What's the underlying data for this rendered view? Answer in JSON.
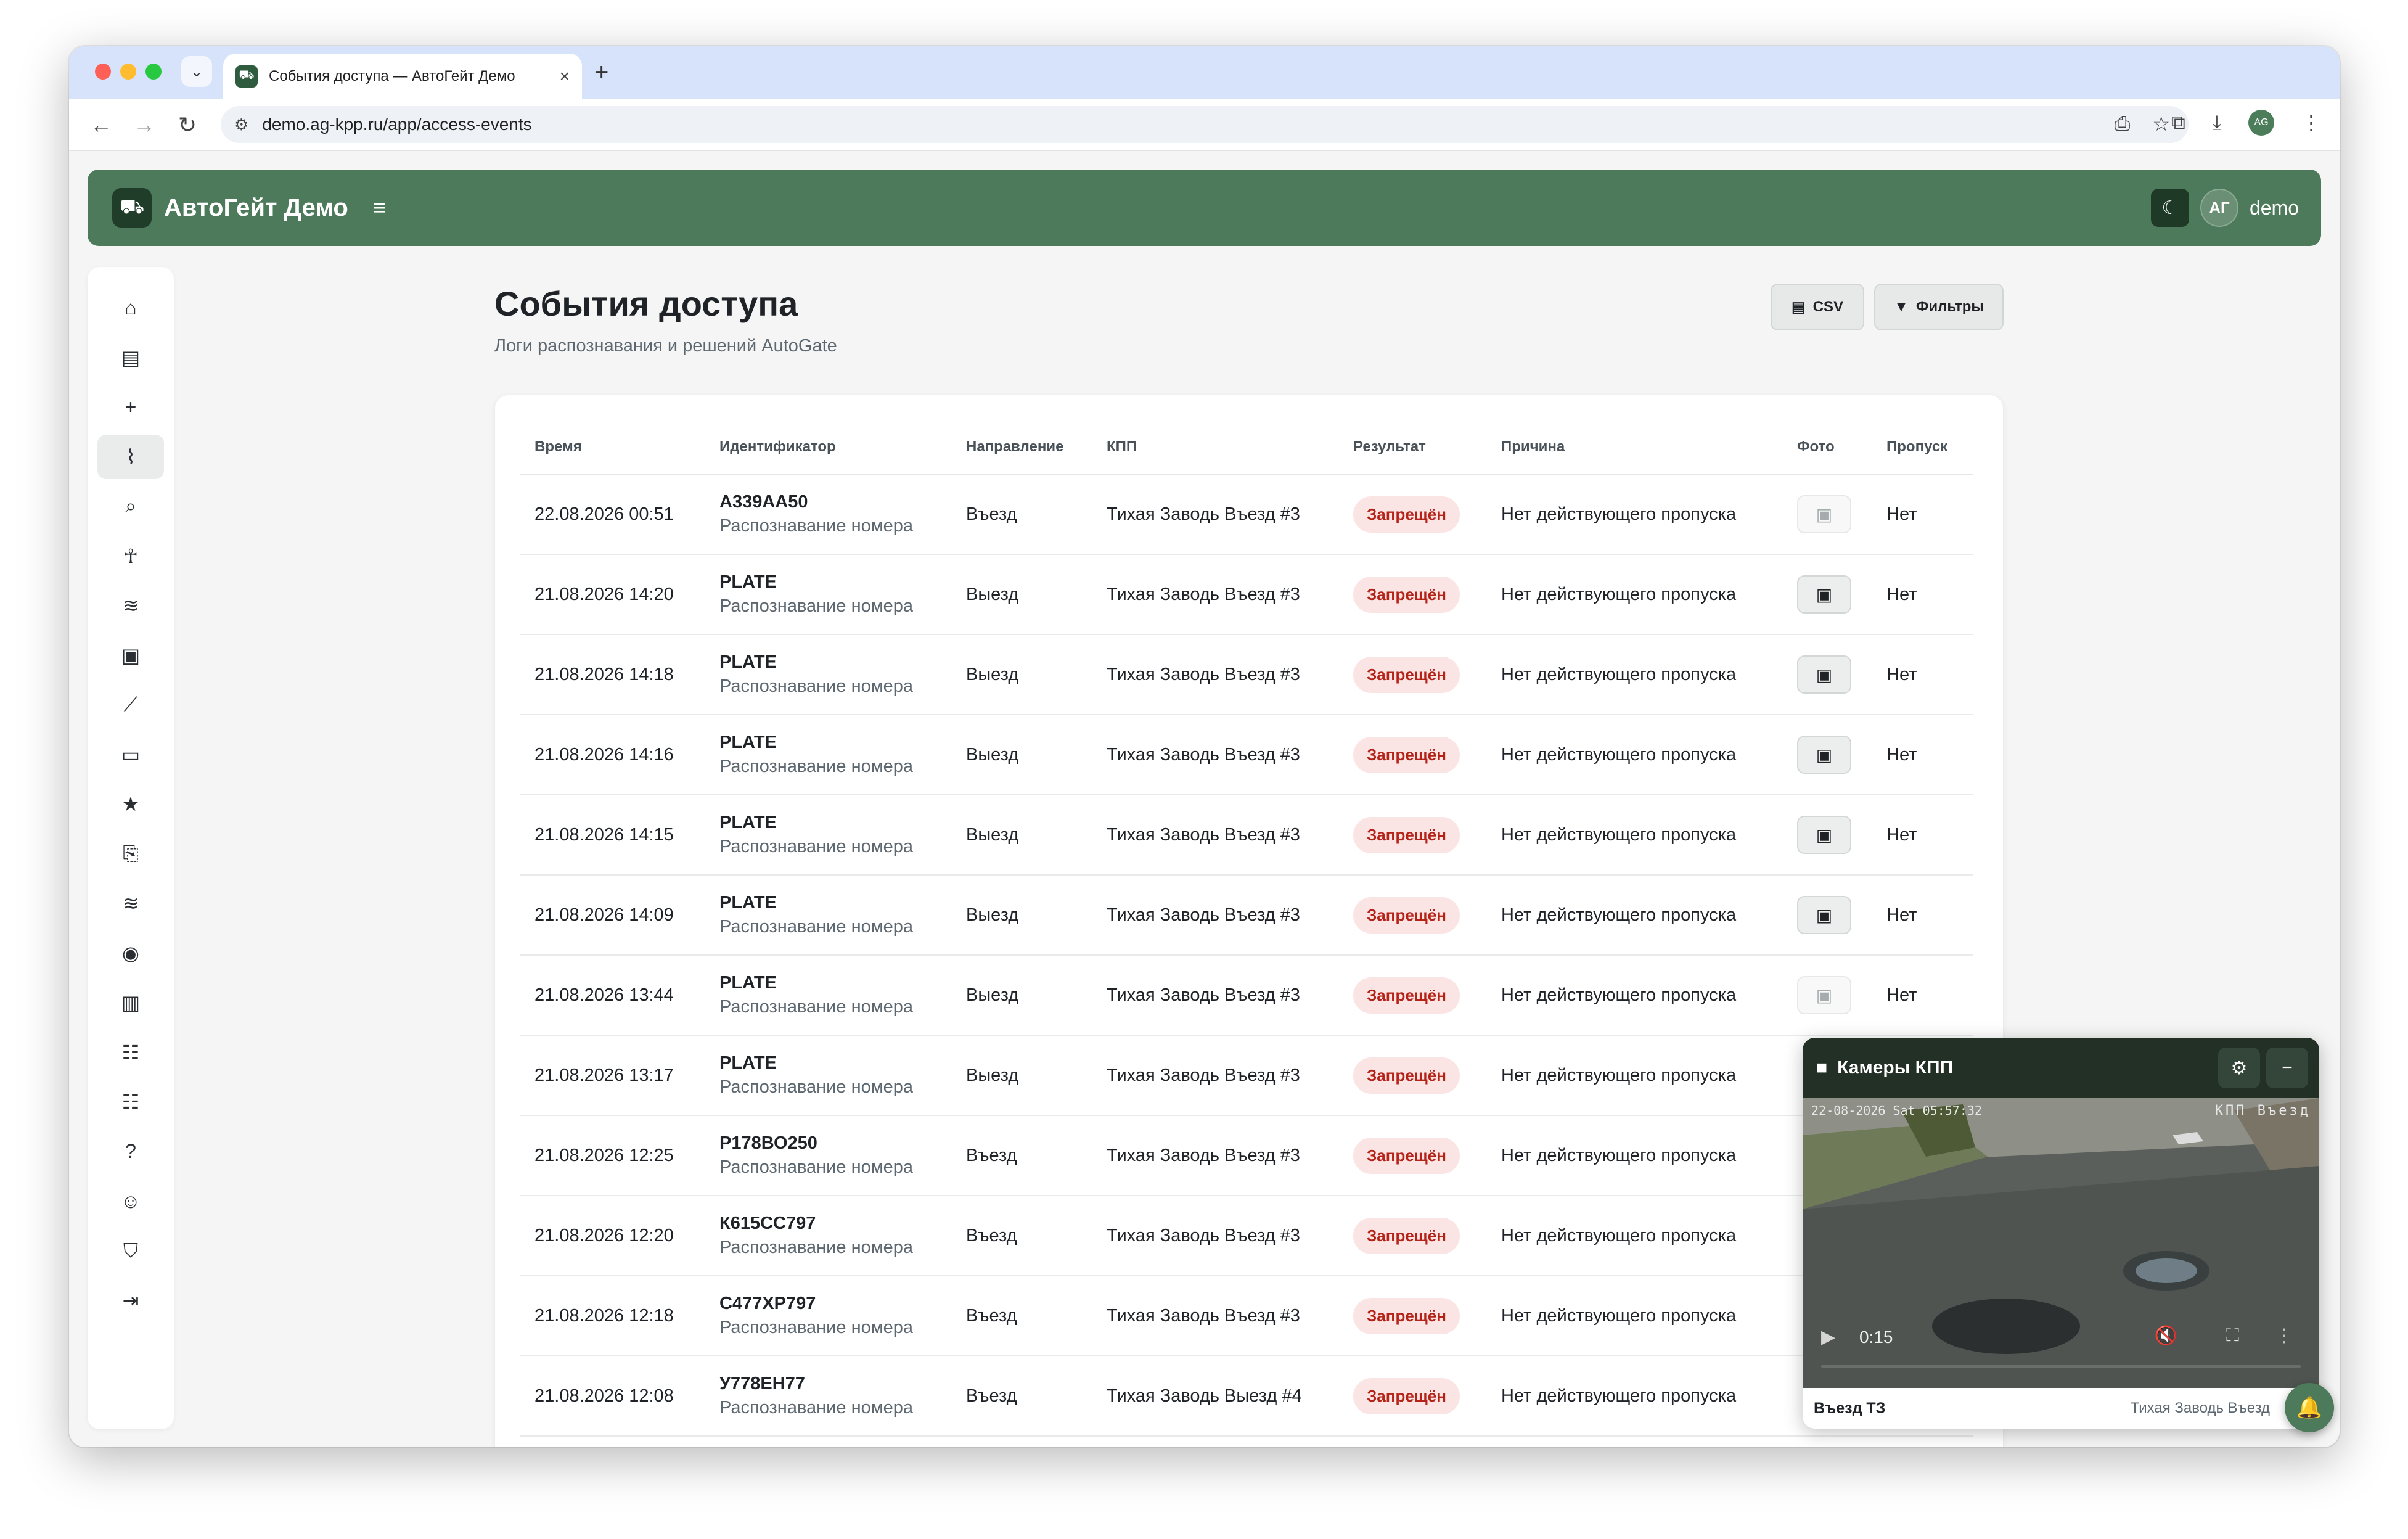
{
  "browser": {
    "tab_title": "События доступа — АвтоГейт Демо",
    "url": "demo.ag-kpp.ru/app/access-events",
    "profile_initials": "AG"
  },
  "app": {
    "brand": "АвтоГейт Демо",
    "user_initials": "АГ",
    "user_name": "demo",
    "accent_color": "#4d7a5a"
  },
  "sidebar": {
    "items": [
      {
        "icon": "home-icon",
        "glyph": "⌂"
      },
      {
        "icon": "id-card-icon",
        "glyph": "▤"
      },
      {
        "icon": "plus-icon",
        "glyph": "+"
      },
      {
        "icon": "activity-icon",
        "glyph": "⌇",
        "active": true
      },
      {
        "icon": "search-icon",
        "glyph": "⌕"
      },
      {
        "icon": "pedestrian-icon",
        "glyph": "☥"
      },
      {
        "icon": "barrier-icon",
        "glyph": "≋"
      },
      {
        "icon": "vehicle-icon",
        "glyph": "▣"
      },
      {
        "icon": "chart-icon",
        "glyph": "⟋"
      },
      {
        "icon": "monitor-icon",
        "glyph": "▭"
      },
      {
        "icon": "star-icon",
        "glyph": "★"
      },
      {
        "icon": "file-export-icon",
        "glyph": "⎘"
      },
      {
        "icon": "barrier-2-icon",
        "glyph": "≋"
      },
      {
        "icon": "camera-icon",
        "glyph": "◉"
      },
      {
        "icon": "building-icon",
        "glyph": "▥"
      },
      {
        "icon": "table-icon",
        "glyph": "☷"
      },
      {
        "icon": "table-2-icon",
        "glyph": "☷"
      },
      {
        "icon": "help-icon",
        "glyph": "?"
      },
      {
        "icon": "user-settings-icon",
        "glyph": "☺"
      },
      {
        "icon": "shield-icon",
        "glyph": "⛉"
      },
      {
        "icon": "logout-icon",
        "glyph": "⇥"
      }
    ]
  },
  "page": {
    "title": "События доступа",
    "subtitle": "Логи распознавания и решений AutoGate",
    "csv_label": "CSV",
    "filters_label": "Фильтры"
  },
  "table": {
    "columns": [
      "Время",
      "Идентификатор",
      "Направление",
      "КПП",
      "Результат",
      "Причина",
      "Фото",
      "Пропуск"
    ],
    "rows": [
      {
        "time": "22.08.2026 00:51",
        "id": "А339АА50",
        "method": "Распознавание номера",
        "direction": "Въезд",
        "checkpoint": "Тихая Заводь Въезд #3",
        "result": "Запрещён",
        "reason": "Нет действующего пропуска",
        "photo": false,
        "pass": "Нет"
      },
      {
        "time": "21.08.2026 14:20",
        "id": "PLATE",
        "method": "Распознавание номера",
        "direction": "Выезд",
        "checkpoint": "Тихая Заводь Въезд #3",
        "result": "Запрещён",
        "reason": "Нет действующего пропуска",
        "photo": true,
        "pass": "Нет"
      },
      {
        "time": "21.08.2026 14:18",
        "id": "PLATE",
        "method": "Распознавание номера",
        "direction": "Выезд",
        "checkpoint": "Тихая Заводь Въезд #3",
        "result": "Запрещён",
        "reason": "Нет действующего пропуска",
        "photo": true,
        "pass": "Нет"
      },
      {
        "time": "21.08.2026 14:16",
        "id": "PLATE",
        "method": "Распознавание номера",
        "direction": "Выезд",
        "checkpoint": "Тихая Заводь Въезд #3",
        "result": "Запрещён",
        "reason": "Нет действующего пропуска",
        "photo": true,
        "pass": "Нет"
      },
      {
        "time": "21.08.2026 14:15",
        "id": "PLATE",
        "method": "Распознавание номера",
        "direction": "Выезд",
        "checkpoint": "Тихая Заводь Въезд #3",
        "result": "Запрещён",
        "reason": "Нет действующего пропуска",
        "photo": true,
        "pass": "Нет"
      },
      {
        "time": "21.08.2026 14:09",
        "id": "PLATE",
        "method": "Распознавание номера",
        "direction": "Выезд",
        "checkpoint": "Тихая Заводь Въезд #3",
        "result": "Запрещён",
        "reason": "Нет действующего пропуска",
        "photo": true,
        "pass": "Нет"
      },
      {
        "time": "21.08.2026 13:44",
        "id": "PLATE",
        "method": "Распознавание номера",
        "direction": "Выезд",
        "checkpoint": "Тихая Заводь Въезд #3",
        "result": "Запрещён",
        "reason": "Нет действующего пропуска",
        "photo": false,
        "pass": "Нет"
      },
      {
        "time": "21.08.2026 13:17",
        "id": "PLATE",
        "method": "Распознавание номера",
        "direction": "Выезд",
        "checkpoint": "Тихая Заводь Въезд #3",
        "result": "Запрещён",
        "reason": "Нет действующего пропуска",
        "photo": null,
        "pass": ""
      },
      {
        "time": "21.08.2026 12:25",
        "id": "Р178ВО250",
        "method": "Распознавание номера",
        "direction": "Въезд",
        "checkpoint": "Тихая Заводь Въезд #3",
        "result": "Запрещён",
        "reason": "Нет действующего пропуска",
        "photo": null,
        "pass": ""
      },
      {
        "time": "21.08.2026 12:20",
        "id": "К615СС797",
        "method": "Распознавание номера",
        "direction": "Въезд",
        "checkpoint": "Тихая Заводь Въезд #3",
        "result": "Запрещён",
        "reason": "Нет действующего пропуска",
        "photo": null,
        "pass": ""
      },
      {
        "time": "21.08.2026 12:18",
        "id": "С477ХР797",
        "method": "Распознавание номера",
        "direction": "Въезд",
        "checkpoint": "Тихая Заводь Въезд #3",
        "result": "Запрещён",
        "reason": "Нет действующего пропуска",
        "photo": null,
        "pass": ""
      },
      {
        "time": "21.08.2026 12:08",
        "id": "У778ЕН77",
        "method": "Распознавание номера",
        "direction": "Въезд",
        "checkpoint": "Тихая Заводь Выезд #4",
        "result": "Запрещён",
        "reason": "Нет действующего пропуска",
        "photo": null,
        "pass": ""
      }
    ]
  },
  "camera": {
    "title": "Камеры КПП",
    "overlay_datetime": "22-08-2026 Sat 05:57:32",
    "overlay_label": "КПП Въезд",
    "time": "0:15",
    "progress": 0.0,
    "camera_name": "Въезд ТЗ",
    "checkpoint": "Тихая Заводь Въезд"
  }
}
